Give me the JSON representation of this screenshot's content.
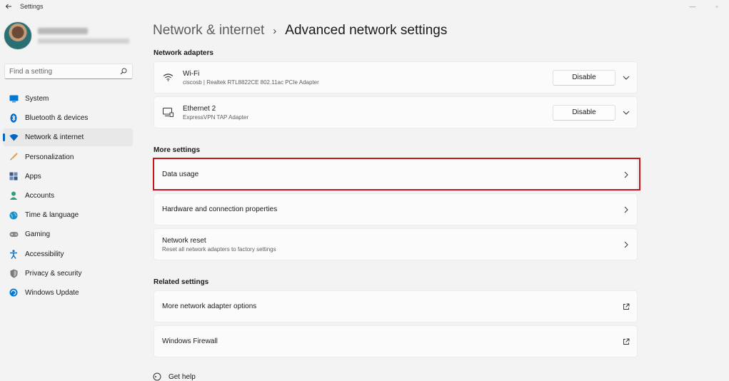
{
  "window": {
    "title": "Settings",
    "back_icon": "back-arrow-icon",
    "controls": [
      "—",
      "▫"
    ]
  },
  "profile": {
    "avatar": "user-avatar",
    "name": "",
    "email": ""
  },
  "search": {
    "placeholder": "Find a setting",
    "icon": "search-icon"
  },
  "sidebar": {
    "items": [
      {
        "label": "System",
        "icon": "system-icon",
        "color": "#0078d4",
        "selected": false
      },
      {
        "label": "Bluetooth & devices",
        "icon": "bluetooth-icon",
        "color": "#0067c0",
        "selected": false
      },
      {
        "label": "Network & internet",
        "icon": "wifi-icon",
        "color": "#0067c0",
        "selected": true
      },
      {
        "label": "Personalization",
        "icon": "brush-icon",
        "color": "#e8a33b",
        "selected": false
      },
      {
        "label": "Apps",
        "icon": "apps-icon",
        "color": "#3a5a8a",
        "selected": false
      },
      {
        "label": "Accounts",
        "icon": "accounts-icon",
        "color": "#2aa17b",
        "selected": false
      },
      {
        "label": "Time & language",
        "icon": "globe-icon",
        "color": "#1b8fc7",
        "selected": false
      },
      {
        "label": "Gaming",
        "icon": "gamepad-icon",
        "color": "#767676",
        "selected": false
      },
      {
        "label": "Accessibility",
        "icon": "accessibility-icon",
        "color": "#1b6fb8",
        "selected": false
      },
      {
        "label": "Privacy & security",
        "icon": "shield-icon",
        "color": "#6b6b6b",
        "selected": false
      },
      {
        "label": "Windows Update",
        "icon": "update-icon",
        "color": "#0078d4",
        "selected": false
      }
    ]
  },
  "breadcrumb": {
    "parent": "Network & internet",
    "separator": "›",
    "current": "Advanced network settings"
  },
  "network_adapters": {
    "label": "Network adapters",
    "items": [
      {
        "name": "Wi-Fi",
        "description": "ciscosb | Realtek RTL8822CE 802.11ac PCIe Adapter",
        "button": "Disable",
        "icon": "wifi-icon"
      },
      {
        "name": "Ethernet 2",
        "description": "ExpressVPN TAP Adapter",
        "button": "Disable",
        "icon": "ethernet-icon"
      }
    ]
  },
  "more_settings": {
    "label": "More settings",
    "items": [
      {
        "title": "Data usage",
        "subtitle": ""
      },
      {
        "title": "Hardware and connection properties",
        "subtitle": ""
      },
      {
        "title": "Network reset",
        "subtitle": "Reset all network adapters to factory settings"
      }
    ]
  },
  "related_settings": {
    "label": "Related settings",
    "items": [
      {
        "title": "More network adapter options"
      },
      {
        "title": "Windows Firewall"
      }
    ]
  },
  "help": {
    "label": "Get help"
  },
  "colors": {
    "accent": "#0067c0",
    "highlight_border": "#c4161c",
    "background": "#f3f3f3",
    "card": "#fbfbfb"
  }
}
